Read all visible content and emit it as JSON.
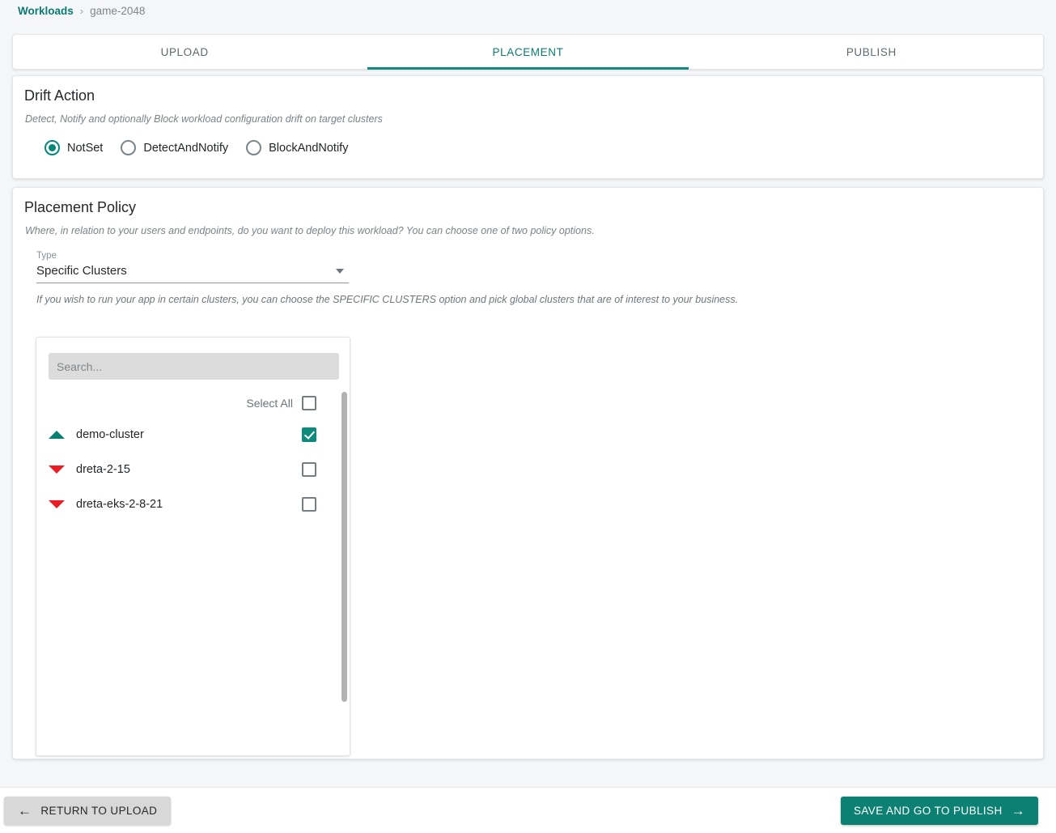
{
  "breadcrumb": {
    "root": "Workloads",
    "separator": "›",
    "current": "game-2048"
  },
  "tabs": [
    {
      "label": "UPLOAD",
      "active": false
    },
    {
      "label": "PLACEMENT",
      "active": true
    },
    {
      "label": "PUBLISH",
      "active": false
    }
  ],
  "drift_action": {
    "title": "Drift Action",
    "subtitle": "Detect, Notify and optionally Block workload configuration drift on target clusters",
    "options": [
      {
        "label": "NotSet",
        "selected": true
      },
      {
        "label": "DetectAndNotify",
        "selected": false
      },
      {
        "label": "BlockAndNotify",
        "selected": false
      }
    ]
  },
  "placement_policy": {
    "title": "Placement Policy",
    "subtitle": "Where, in relation to your users and endpoints, do you want to deploy this workload? You can choose one of two policy options.",
    "type_field": {
      "label": "Type",
      "value": "Specific Clusters",
      "caret_icon": "chevron-down-icon"
    },
    "help_text": "If you wish to run your app in certain clusters, you can choose the SPECIFIC CLUSTERS option and pick global clusters that are of interest to your business.",
    "cluster_picker": {
      "search": {
        "value": "",
        "placeholder": "Search..."
      },
      "select_all": {
        "label": "Select All",
        "checked": false
      },
      "clusters": [
        {
          "name": "demo-cluster",
          "status": "up",
          "checked": true
        },
        {
          "name": "dreta-2-15",
          "status": "down",
          "checked": false
        },
        {
          "name": "dreta-eks-2-8-21",
          "status": "down",
          "checked": false
        }
      ]
    }
  },
  "footer": {
    "back_button": {
      "label": "RETURN TO UPLOAD",
      "icon": "arrow-left-icon"
    },
    "primary_button": {
      "label": "SAVE AND GO TO PUBLISH",
      "icon": "arrow-right-icon"
    }
  },
  "colors": {
    "accent": "#0d8a7c",
    "accent_dark": "#0b7b72",
    "status_up": "#087e72",
    "status_down": "#ec1c24",
    "page_bg": "#f4f6f8",
    "card_bg": "#ffffff"
  }
}
